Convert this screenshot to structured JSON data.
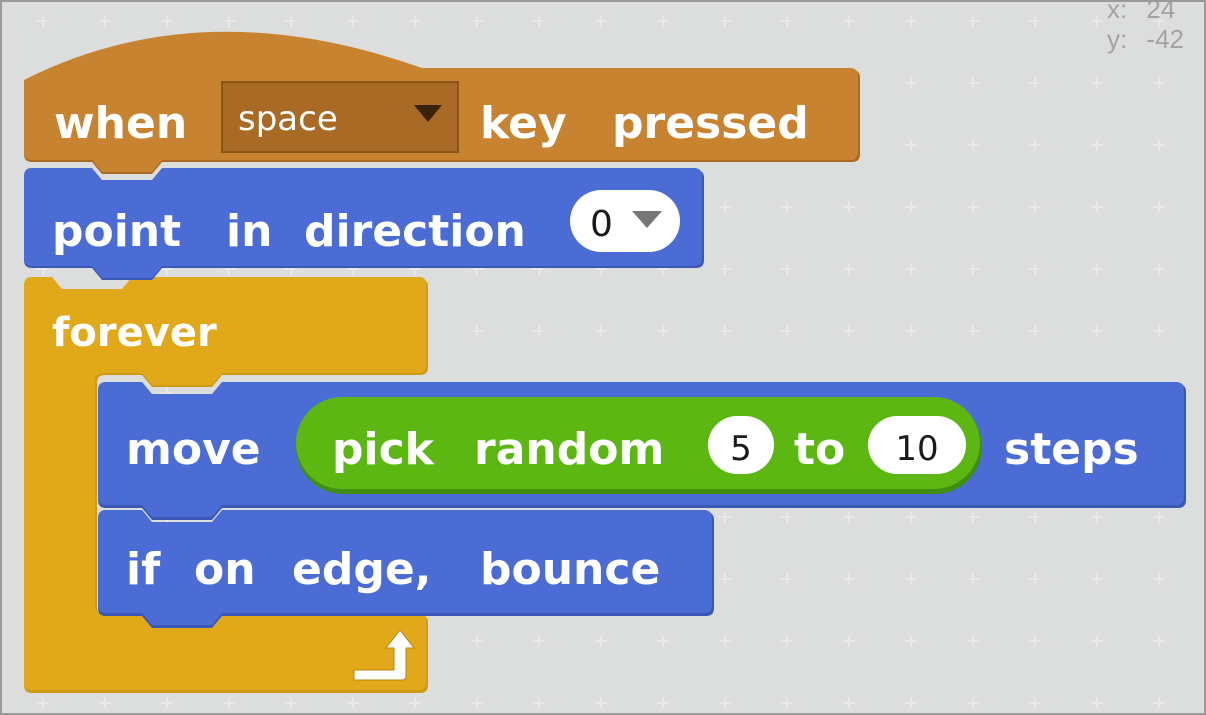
{
  "workspace": {
    "coords": {
      "x_label": "x:",
      "x_value": "24",
      "y_label": "y:",
      "y_value": "-42"
    }
  },
  "script": {
    "hat_block": {
      "word1": "when",
      "key_dropdown": "space",
      "word2": "key",
      "word3": "pressed",
      "color": "#c88330"
    },
    "point_block": {
      "word1": "point",
      "word2": "in",
      "word3": "direction",
      "direction_value": "0",
      "color": "#4a6cd4"
    },
    "forever_block": {
      "label": "forever",
      "color": "#e1a91a"
    },
    "move_block": {
      "word1": "move",
      "word2": "steps",
      "color": "#4a6cd4",
      "reporter": {
        "word1": "pick",
        "word2": "random",
        "from_value": "5",
        "word3": "to",
        "to_value": "10",
        "color": "#5cb712"
      }
    },
    "bounce_block": {
      "word1": "if",
      "word2": "on",
      "word3": "edge,",
      "word4": "bounce",
      "color": "#4a6cd4"
    }
  }
}
